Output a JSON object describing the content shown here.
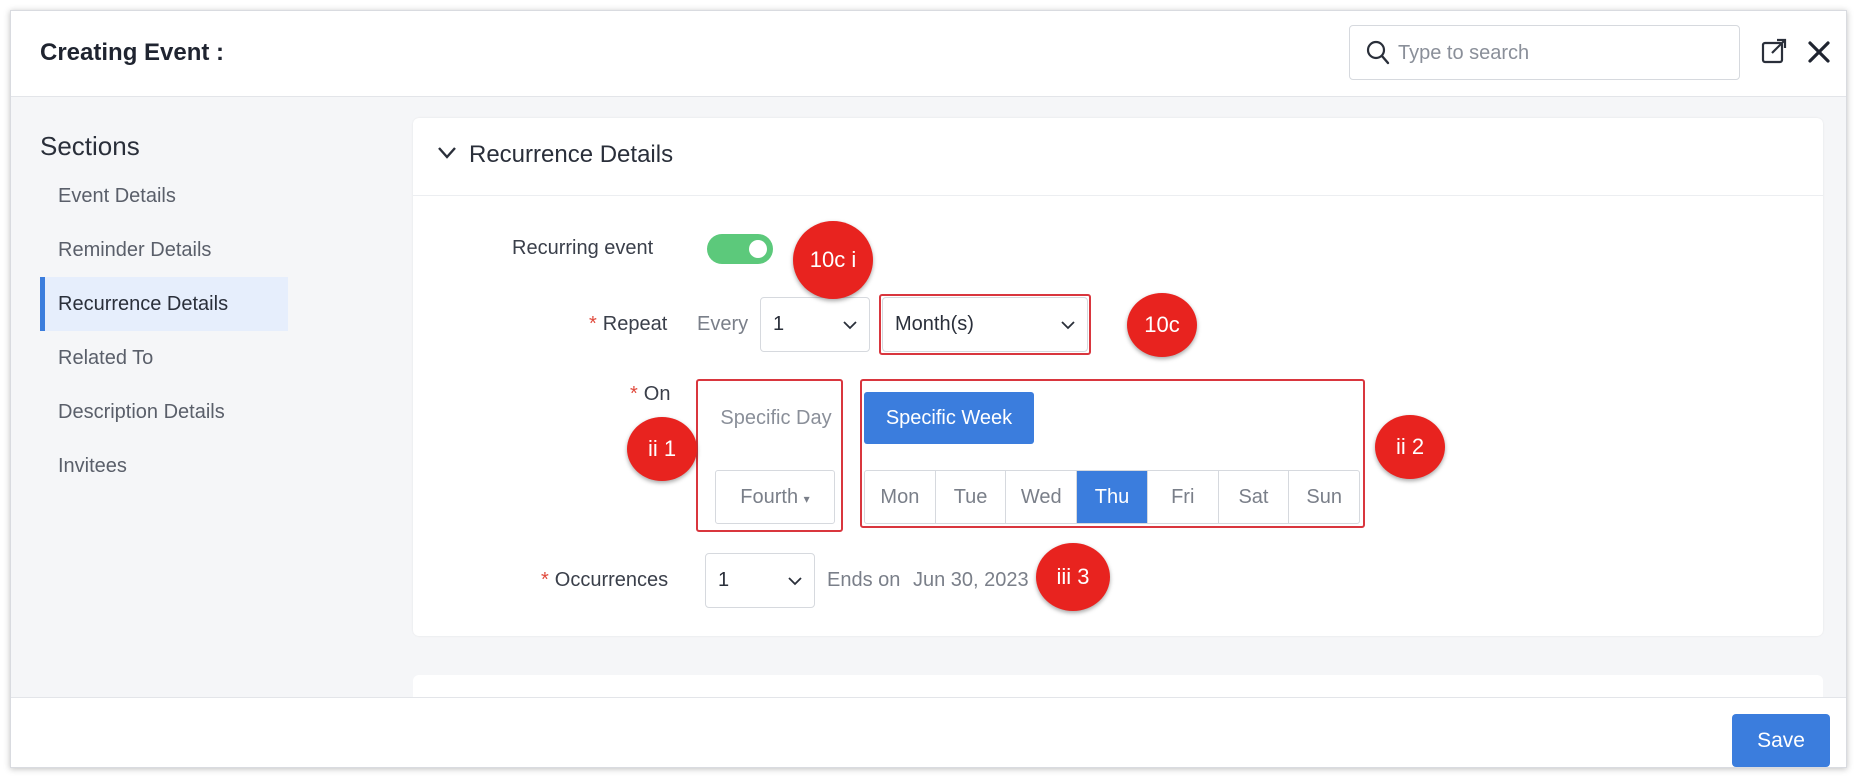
{
  "header": {
    "title": "Creating Event :",
    "search_placeholder": "Type to search"
  },
  "sidebar": {
    "title": "Sections",
    "items": [
      {
        "label": "Event Details"
      },
      {
        "label": "Reminder Details"
      },
      {
        "label": "Recurrence Details"
      },
      {
        "label": "Related To"
      },
      {
        "label": "Description Details"
      },
      {
        "label": "Invitees"
      }
    ]
  },
  "recurrence": {
    "title": "Recurrence Details",
    "recurring_label": "Recurring event",
    "recurring_on": true,
    "repeat_label": "Repeat",
    "every_label": "Every",
    "every_value": "1",
    "period_value": "Month(s)",
    "on_label": "On",
    "specific_day_label": "Specific Day",
    "specific_week_label": "Specific Week",
    "ordinal_value": "Fourth",
    "days": [
      "Mon",
      "Tue",
      "Wed",
      "Thu",
      "Fri",
      "Sat",
      "Sun"
    ],
    "selected_day": "Thu",
    "occurrences_label": "Occurrences",
    "occurrences_value": "1",
    "ends_on_label": "Ends on",
    "ends_on_value": "Jun 30, 2023"
  },
  "annotations": {
    "a1": "10c i",
    "a2": "10c",
    "a3": "ii 1",
    "a4": "ii 2",
    "a5": "iii 3"
  },
  "footer": {
    "save_label": "Save"
  },
  "colors": {
    "accent": "#3b7ddd",
    "toggle_on": "#5cc97b",
    "annotation_red": "#e8231f",
    "required": "#e0493c"
  }
}
